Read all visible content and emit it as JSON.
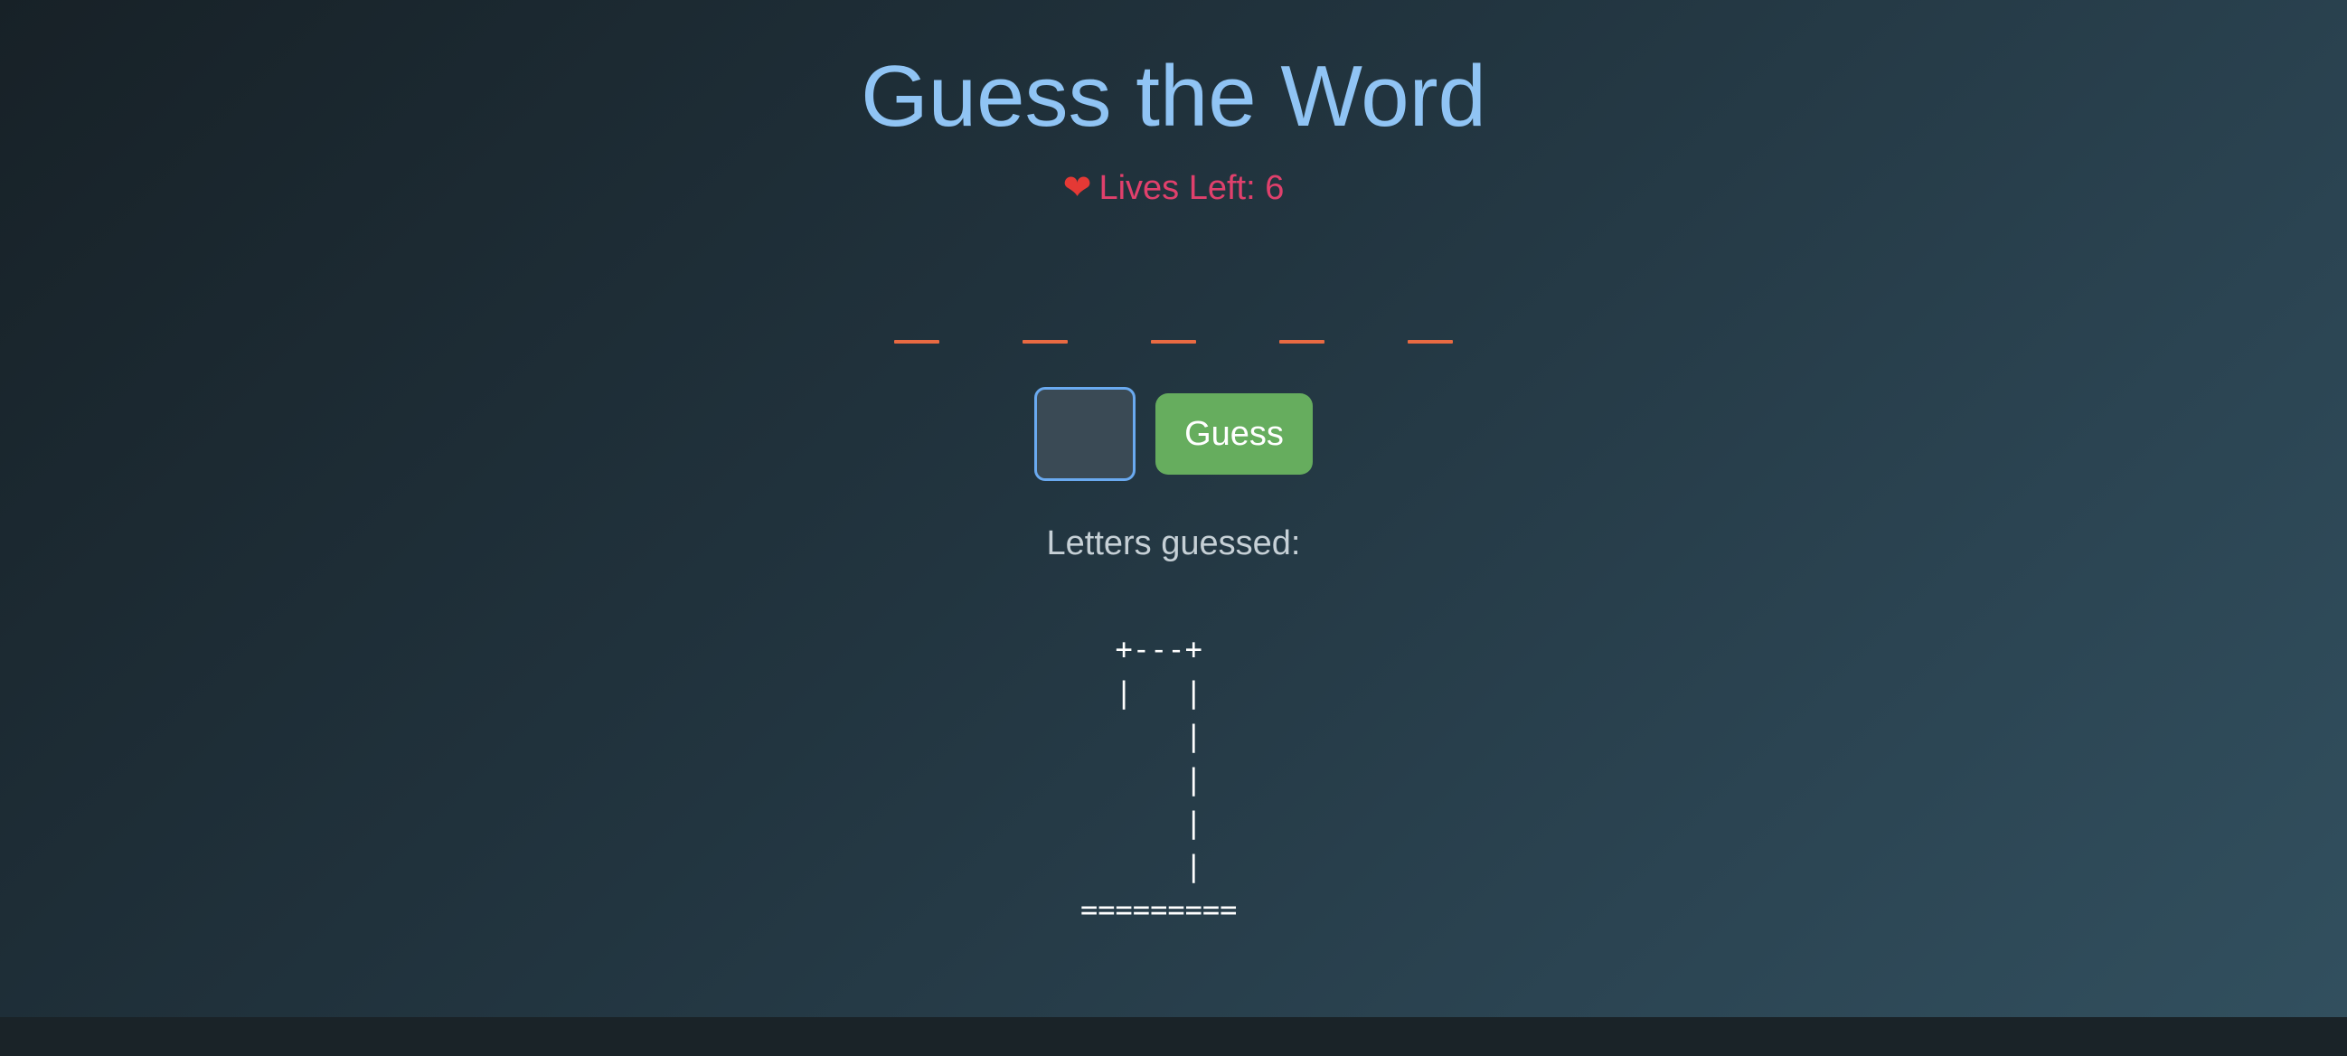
{
  "title": "Guess the Word",
  "lives": {
    "icon": "heart-icon",
    "label": "Lives Left: 6",
    "value": 6,
    "color": "#e0406c"
  },
  "word": {
    "slots": [
      "_",
      "_",
      "_",
      "_",
      "_"
    ],
    "slot_color": "#e96a42"
  },
  "guess": {
    "input_value": "",
    "button_label": "Guess",
    "button_color": "#66ad5e"
  },
  "letters_guessed": {
    "label": "Letters guessed:",
    "letters": []
  },
  "gallows_art": "  +---+\n  |   |\n      |\n      |\n      |\n      |\n=========",
  "colors": {
    "title": "#90c4f4",
    "accent_border": "#6aaaf0"
  }
}
